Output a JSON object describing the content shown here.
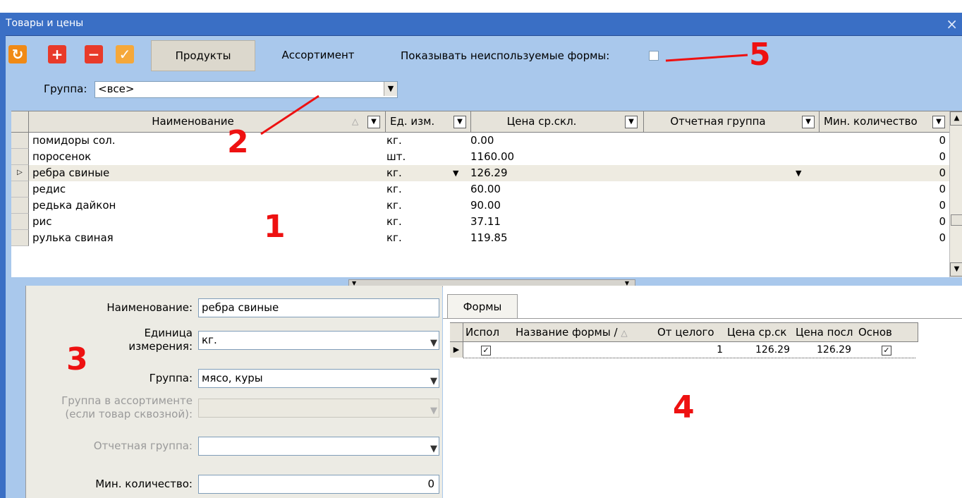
{
  "window": {
    "title": "Товары и цены",
    "close_glyph": "×"
  },
  "toolbar": {
    "buttons": [
      {
        "icon": "refresh-icon",
        "glyph": "↻",
        "color": "#f08a16"
      },
      {
        "icon": "plus-icon",
        "glyph": "+",
        "color": "#e83a2a"
      },
      {
        "icon": "minus-icon",
        "glyph": "−",
        "color": "#e83a2a"
      },
      {
        "icon": "check-icon",
        "glyph": "✓",
        "color": "#f5a83a"
      }
    ],
    "tabs": [
      "Продукты",
      "Ассортимент"
    ],
    "show_unused_label": "Показывать неиспользуемые формы:"
  },
  "group_filter": {
    "label": "Группа:",
    "value": "<все>"
  },
  "grid": {
    "columns": [
      "Наименование",
      "Ед. изм.",
      "Цена ср.скл.",
      "Отчетная группа",
      "Мин. количество"
    ],
    "sort_glyph": "△",
    "rows": [
      {
        "name": "помидоры сол.",
        "unit": "кг.",
        "price": "0.00",
        "report": "",
        "min": "0"
      },
      {
        "name": "поросенок",
        "unit": "шт.",
        "price": "1160.00",
        "report": "",
        "min": "0"
      },
      {
        "name": "ребра свиные",
        "unit": "кг.",
        "price": "126.29",
        "report": "",
        "min": "0"
      },
      {
        "name": "редис",
        "unit": "кг.",
        "price": "60.00",
        "report": "",
        "min": "0"
      },
      {
        "name": "редька дайкон",
        "unit": "кг.",
        "price": "90.00",
        "report": "",
        "min": "0"
      },
      {
        "name": "рис",
        "unit": "кг.",
        "price": "37.11",
        "report": "",
        "min": "0"
      },
      {
        "name": "рулька свиная",
        "unit": "кг.",
        "price": "119.85",
        "report": "",
        "min": "0"
      }
    ]
  },
  "editor": {
    "name_label": "Наименование:",
    "name_value": "ребра свиные",
    "unit_label_1": "Единица",
    "unit_label_2": "измерения:",
    "unit_value": "кг.",
    "group_label": "Группа:",
    "group_value": "мясо, куры",
    "assort_label_1": "Группа в ассортименте",
    "assort_label_2": "(если товар сквозной):",
    "assort_value": "",
    "report_label": "Отчетная группа:",
    "report_value": "",
    "min_label": "Мин. количество:",
    "min_value": "0"
  },
  "forms": {
    "tab_label": "Формы",
    "columns": [
      "Испол",
      "Название формы /",
      "От целого",
      "Цена ср.ск",
      "Цена посл",
      "Основ"
    ],
    "row": {
      "used": true,
      "name": "",
      "from_whole": "1",
      "avg_price": "126.29",
      "last_price": "126.29",
      "main": true
    }
  },
  "annotations": [
    "1",
    "2",
    "3",
    "4",
    "5"
  ]
}
